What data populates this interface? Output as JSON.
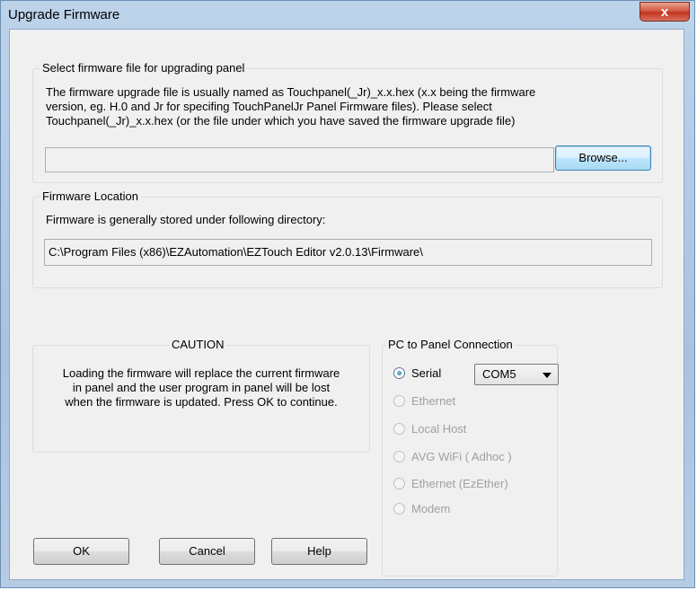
{
  "window": {
    "title": "Upgrade Firmware",
    "close_symbol": "x"
  },
  "select_group": {
    "title": "Select firmware file for upgrading panel",
    "description_lines": [
      "The firmware upgrade file is usually named as Touchpanel(_Jr)_x.x.hex (x.x being the firmware",
      "version, eg. H.0 and Jr for specifing TouchPanelJr Panel Firmware files).  Please select",
      "Touchpanel(_Jr)_x.x.hex (or the file under which you have saved the firmware upgrade file)"
    ],
    "file_path_value": "",
    "browse_label": "Browse..."
  },
  "location_group": {
    "title": "Firmware Location",
    "description": "Firmware is generally stored under following directory:",
    "path": "C:\\Program Files (x86)\\EZAutomation\\EZTouch Editor v2.0.13\\Firmware\\"
  },
  "caution_group": {
    "title": "CAUTION",
    "lines": [
      "Loading the firmware will replace the current firmware",
      "in panel and  the user program in  panel will be lost",
      "when the firmware is updated.  Press OK to continue."
    ]
  },
  "connection_group": {
    "title": "PC to Panel Connection",
    "options": [
      {
        "label": "Serial",
        "checked": true,
        "enabled": true
      },
      {
        "label": "Ethernet",
        "checked": false,
        "enabled": false
      },
      {
        "label": "Local Host",
        "checked": false,
        "enabled": false
      },
      {
        "label": "AVG WiFi ( Adhoc )",
        "checked": false,
        "enabled": false
      },
      {
        "label": "Ethernet (EzEther)",
        "checked": false,
        "enabled": false
      },
      {
        "label": "Modem",
        "checked": false,
        "enabled": false
      }
    ],
    "port_selected": "COM5"
  },
  "buttons": {
    "ok": "OK",
    "cancel": "Cancel",
    "help": "Help"
  }
}
